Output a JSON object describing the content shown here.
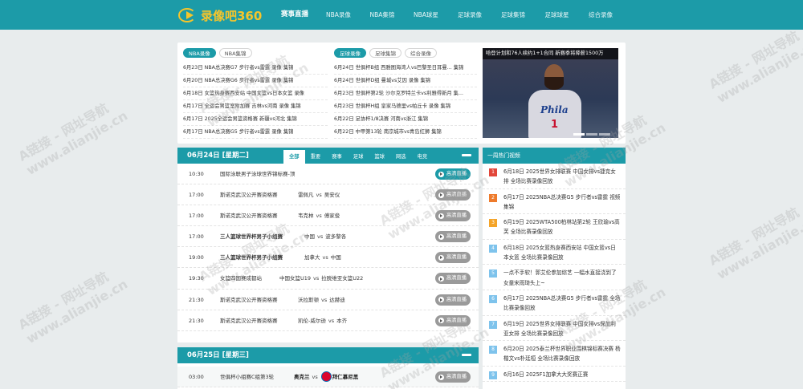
{
  "header": {
    "logo_text": "录像吧360",
    "nav": [
      "赛事直播",
      "NBA录像",
      "NBA集锦",
      "NBA球星",
      "足球录像",
      "足球集锦",
      "足球球星",
      "综合录像"
    ]
  },
  "top": {
    "nba_tabs": [
      "NBA录像",
      "NBA集锦"
    ],
    "nba_news": [
      "6月23日 NBA总决赛G7 步行者vs雷霆 录像 集锦",
      "6月20日 NBA总决赛G6 步行者vs雷霆 录像 集锦",
      "6月18日 女篮热身赛西安站 中国女篮vs日本女篮 录像",
      "6月17日 全运会男篮室附加赛 吉林vs河南 录像 集锦",
      "6月17日 2025全运会男篮资格赛 新疆vs河北 集锦",
      "6月17日 NBA总决赛G5 步行者vs雷霆 录像 集锦"
    ],
    "foot_tabs": [
      "足球录像",
      "足球集锦",
      "综合录像"
    ],
    "foot_news": [
      "6月24日 世俱杯B组 西雅图海湾人vs巴黎圣日耳曼... 集锦",
      "6月24日 世俱杯D组 曼城vs艾因 录像 集锦",
      "6月23日 世俱杯第2轮 沙尔克罗特兰卡vs利雅得新月 集...",
      "6月23日 世俱杯H组 皇家马德里vs帕丘卡 录像 集锦",
      "6月22日 足协杯1/8决赛 河南vs浙江 集锦",
      "6月22日 中甲第13轮 南京城市vs青岛红狮 集锦"
    ],
    "banner_caption": "哈登计划和76人续约1+1合同 新赛季将降薪1500万"
  },
  "schedule": [
    {
      "date": "06月24日 [星期二]",
      "tabs": [
        "全部",
        "重要",
        "赛事",
        "足球",
        "篮球",
        "网选",
        "电竞"
      ],
      "rows": [
        {
          "time": "10:30",
          "event": "国际泳联男子泳球世界锦标赛-顶",
          "home": "",
          "away": "",
          "bold": false,
          "btn": "高清直播",
          "hi": true
        },
        {
          "time": "17:00",
          "event": "斯诺克武汉公开赛资格赛",
          "home": "雷佩凡",
          "away": "吴安仪",
          "bold": false,
          "btn": "高清直播",
          "hi": false
        },
        {
          "time": "17:00",
          "event": "斯诺克武汉公开赛资格赛",
          "home": "韦克林",
          "away": "傅家俊",
          "bold": false,
          "btn": "高清直播",
          "hi": false
        },
        {
          "time": "17:00",
          "event": "三人篮球世界杯男子小组赛",
          "home": "中国",
          "away": "波多黎各",
          "bold": true,
          "btn": "高清直播",
          "hi": false
        },
        {
          "time": "19:00",
          "event": "三人篮球世界杯男子小组赛",
          "home": "加拿大",
          "away": "中国",
          "bold": true,
          "btn": "高清直播",
          "hi": false
        },
        {
          "time": "19:30",
          "event": "女篮四国赛成都站",
          "home": "中国女篮U19",
          "away": "拉脱维亚女篮U22",
          "bold": false,
          "btn": "高清直播",
          "hi": false
        },
        {
          "time": "21:30",
          "event": "斯诺克武汉公开赛资格赛",
          "home": "沃拉斯顿",
          "away": "达赫迪",
          "bold": false,
          "btn": "高清直播",
          "hi": false
        },
        {
          "time": "21:30",
          "event": "斯诺克武汉公开赛资格赛",
          "home": "凯伦-威尔逊",
          "away": "本齐",
          "bold": false,
          "btn": "高清直播",
          "hi": false
        }
      ]
    },
    {
      "date": "06月25日 [星期三]",
      "rows": [
        {
          "time": "03:00",
          "event": "世俱杯小组赛C组第3轮",
          "home": "奥克兰",
          "away": "拜仁慕尼黑",
          "bold": true,
          "btn": "高清直播",
          "hi": false
        }
      ]
    }
  ],
  "hot": {
    "title": "一周热门视频",
    "items": [
      "6月18日 2025世界女排联赛 中国女排vs捷克女排 全场比赛录像回放",
      "6月17日 2025NBA总决赛G5 步行者vs雷霆 视频集锦",
      "6月19日 2025WTA500柏林站第2轮 王欣瑜vs高芙 全场比赛录像回放",
      "6月18日 2025女篮热身赛西安站 中国女篮vs日本女篮 全场比赛录像回放",
      "一点不手软！郭艾伦参加综艺 一幅水直接浇到了女童宋雨琦头上~",
      "6月17日 2025NBA总决赛G5 步行者vs雷霆 全场比赛录像回放",
      "6月19日 2025世界女排联赛 中国女排vs保加利亚女排 全场比赛录像回放",
      "6月20日 2025泰兰杯世界职业围棋锦标赛决赛 杨楷文vs朴廷桓 全场比赛录像回放",
      "6月16日 2025F1加拿大大奖赛正赛"
    ]
  }
}
